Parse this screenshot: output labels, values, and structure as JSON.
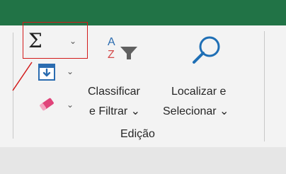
{
  "ribbon": {
    "group_label": "Edição",
    "autosum": {
      "icon": "sigma-icon",
      "dropdown": "⌄"
    },
    "fill": {
      "icon": "fill-down-icon",
      "dropdown": "⌄"
    },
    "clear": {
      "icon": "eraser-icon",
      "dropdown": "⌄"
    },
    "sort_filter": {
      "icon": "sort-az-filter-icon",
      "label_line1": "Classificar",
      "label_line2": "e Filtrar ⌄"
    },
    "find_select": {
      "icon": "magnifier-icon",
      "label_line1": "Localizar e",
      "label_line2": "Selecionar ⌄"
    }
  },
  "colors": {
    "title_strip": "#217346",
    "highlight": "#d21a1a",
    "fill_icon": "#2b6cb0",
    "eraser_icon": "#e0447a",
    "magnifier_icon": "#1f6fb5"
  }
}
